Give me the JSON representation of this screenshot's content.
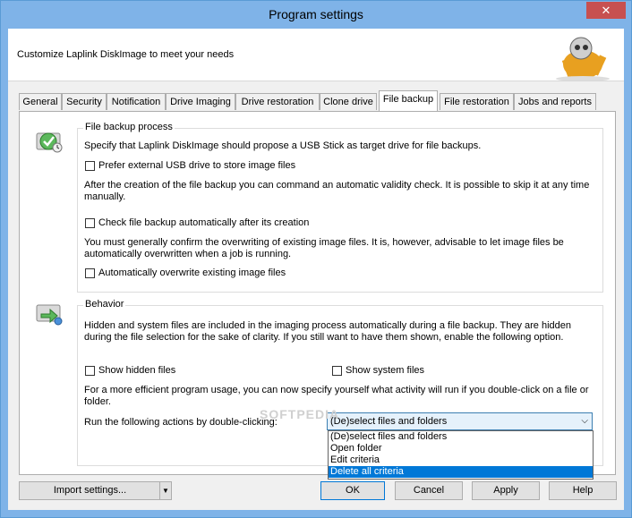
{
  "window": {
    "title": "Program settings",
    "close_glyph": "✕"
  },
  "header": {
    "text": "Customize Laplink DiskImage to meet your needs",
    "mascot_icon": "robot-mascot-icon"
  },
  "tabs": [
    {
      "label": "General"
    },
    {
      "label": "Security"
    },
    {
      "label": "Notification"
    },
    {
      "label": "Drive Imaging"
    },
    {
      "label": "Drive restoration"
    },
    {
      "label": "Clone drive"
    },
    {
      "label": "File backup"
    },
    {
      "label": "File restoration"
    },
    {
      "label": "Jobs and reports"
    }
  ],
  "active_tab": "File backup",
  "file_backup_process": {
    "title": "File backup process",
    "icon": "file-backup-icon",
    "intro": "Specify that Laplink DiskImage should propose a USB Stick as target drive for file backups.",
    "prefer_usb_label": "Prefer external USB drive to store image files",
    "validity_text": "After the creation of the file backup you can command an automatic validity check. It is possible to skip it at any time manually.",
    "check_label": "Check file backup automatically after its creation",
    "overwrite_text": "You must generally confirm the overwriting of existing image files. It is, however, advisable to let image files be automatically overwritten when a job is running.",
    "overwrite_label": "Automatically overwrite existing image files"
  },
  "behavior": {
    "title": "Behavior",
    "icon": "behavior-icon",
    "hidden_text": "Hidden and system files are included in the imaging process automatically during a file backup. They are hidden during the file selection for the sake of clarity. If you still want to have them shown, enable the following option.",
    "show_hidden_label": "Show hidden files",
    "show_system_label": "Show system files",
    "doubleclick_text": "For a more efficient program usage, you can now specify yourself what activity will run if you double-click on a file or folder.",
    "run_label": "Run the following actions by double-clicking:",
    "selected_option": "(De)select files and folders",
    "options": [
      "(De)select files and folders",
      "Open folder",
      "Edit criteria",
      "Delete all criteria"
    ],
    "highlighted_option": "Delete all criteria"
  },
  "buttons": {
    "import": "Import settings...",
    "import_arrow": "▼",
    "ok": "OK",
    "cancel": "Cancel",
    "apply": "Apply",
    "help": "Help"
  },
  "watermark": "SOFTPEDIA"
}
